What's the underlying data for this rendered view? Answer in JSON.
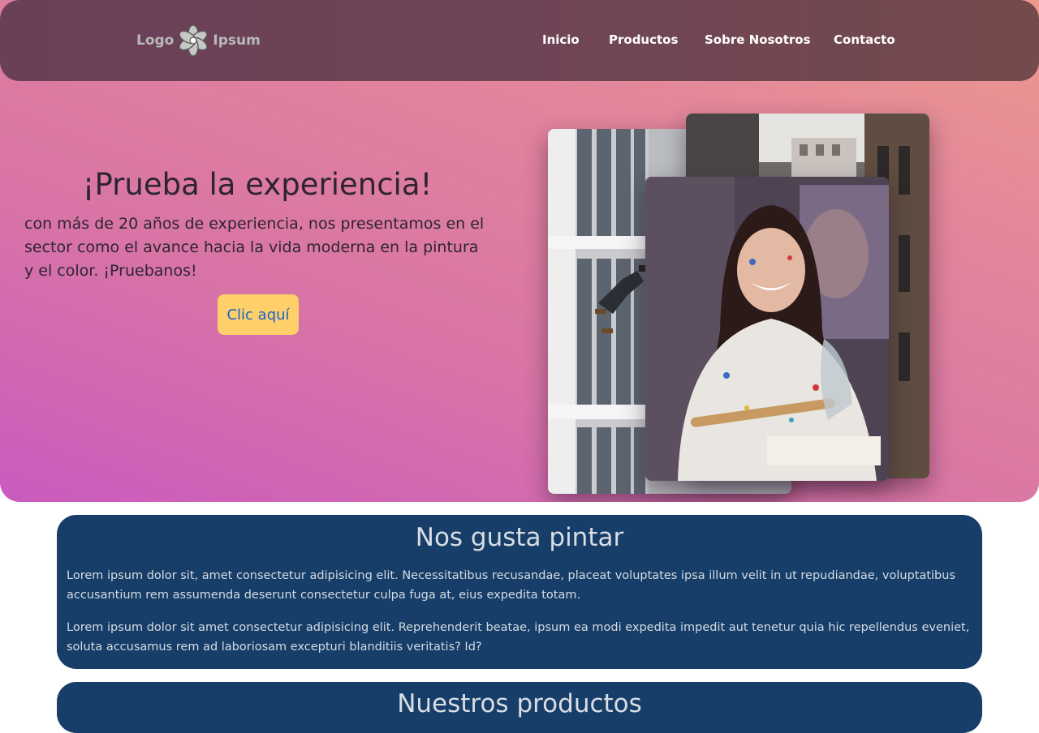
{
  "header": {
    "logo": {
      "word_left": "Logo",
      "word_right": "Ipsum",
      "icon": "flower-logo-icon"
    },
    "nav": [
      {
        "label": "Inicio"
      },
      {
        "label": "Productos"
      },
      {
        "label": "Sobre Nosotros"
      },
      {
        "label": "Contacto"
      }
    ]
  },
  "hero": {
    "title": "¡Prueba la experiencia!",
    "text": "con más de 20 años de experiencia, nos presentamos en el sector como el avance hacia la vida moderna en la pintura y el color. ¡Pruebanos!",
    "cta_label": "Clic aquí",
    "images": [
      "building-window-climber-photo",
      "old-town-street-photo",
      "smiling-painter-woman-photo"
    ]
  },
  "about": {
    "title": "Nos gusta pintar",
    "paragraphs": [
      "Lorem ipsum dolor sit, amet consectetur adipisicing elit. Necessitatibus recusandae, placeat voluptates ipsa illum velit in ut repudiandae, voluptatibus accusantium rem assumenda deserunt consectetur culpa fuga at, eius expedita totam.",
      "Lorem ipsum dolor sit amet consectetur adipisicing elit. Reprehenderit beatae, ipsum ea modi expedita impedit aut tenetur quia hic repellendus eveniet, soluta accusamus rem ad laboriosam excepturi blanditiis veritatis? Id?"
    ]
  },
  "products": {
    "title": "Nuestros productos"
  },
  "colors": {
    "header_bg": "#6f4456",
    "hero_gradient_start": "#c95bbe",
    "hero_gradient_end": "#ec9a8e",
    "cta_bg": "#ffcf6a",
    "cta_text": "#1764c9",
    "panel_bg": "#163e68"
  }
}
